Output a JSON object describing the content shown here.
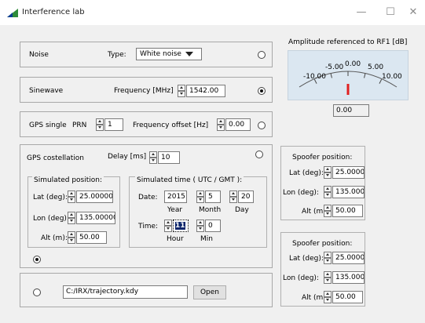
{
  "window": {
    "title": "Interference lab",
    "minimize": "—",
    "maximize": "☐",
    "close": "✕"
  },
  "noise": {
    "label": "Noise",
    "type_label": "Type:",
    "type_value": "White noise",
    "selected": false
  },
  "sinewave": {
    "label": "Sinewave",
    "freq_label": "Frequency [MHz]",
    "freq_value": "1542.00",
    "selected": true
  },
  "gps_single": {
    "label": "GPS single",
    "prn_label": "PRN",
    "prn_value": "1",
    "offset_label": "Frequency offset [Hz]",
    "offset_value": "0.00",
    "selected": false
  },
  "gps_constellation": {
    "label": "GPS costellation",
    "delay_label": "Delay [ms]",
    "delay_value": "10",
    "selected": false,
    "bottom_radio_selected": true,
    "sim_position": {
      "title": "Simulated position:",
      "lat_label": "Lat (deg):",
      "lat_value": "25.00000",
      "lon_label": "Lon (deg):",
      "lon_value": "135.00000",
      "alt_label": "Alt (m):",
      "alt_value": "50.00"
    },
    "sim_time": {
      "title": "Simulated time ( UTC / GMT ):",
      "date_label": "Date:",
      "year_value": "2015",
      "month_value": "5",
      "day_value": "20",
      "year_label": "Year",
      "month_label": "Month",
      "day_label": "Day",
      "time_label": "Time:",
      "hour_value": "11",
      "min_value": "0",
      "hour_label": "Hour",
      "min_label": "Min"
    }
  },
  "trajectory": {
    "path": "C:/IRX/trajectory.kdy",
    "open_label": "Open",
    "selected": false
  },
  "meter": {
    "title": "Amplitude referenced to RF1 [dB]",
    "scale_labels": [
      "-10.00",
      "-5.00",
      "0.00",
      "5.00",
      "10.00"
    ],
    "value": "0.00",
    "needle_value": 0.0,
    "needle_color": "#e02020"
  },
  "spoofer1": {
    "title": "Spoofer position:",
    "lat_label": "Lat (deg):",
    "lat_value": "25.00000",
    "lon_label": "Lon (deg):",
    "lon_value": "135.00000",
    "alt_label": "Alt (m):",
    "alt_value": "50.00"
  },
  "spoofer2": {
    "title": "Spoofer position:",
    "lat_label": "Lat (deg):",
    "lat_value": "25.00000",
    "lon_label": "Lon (deg):",
    "lon_value": "135.00000",
    "alt_label": "Alt (m):",
    "alt_value": "50.00"
  }
}
